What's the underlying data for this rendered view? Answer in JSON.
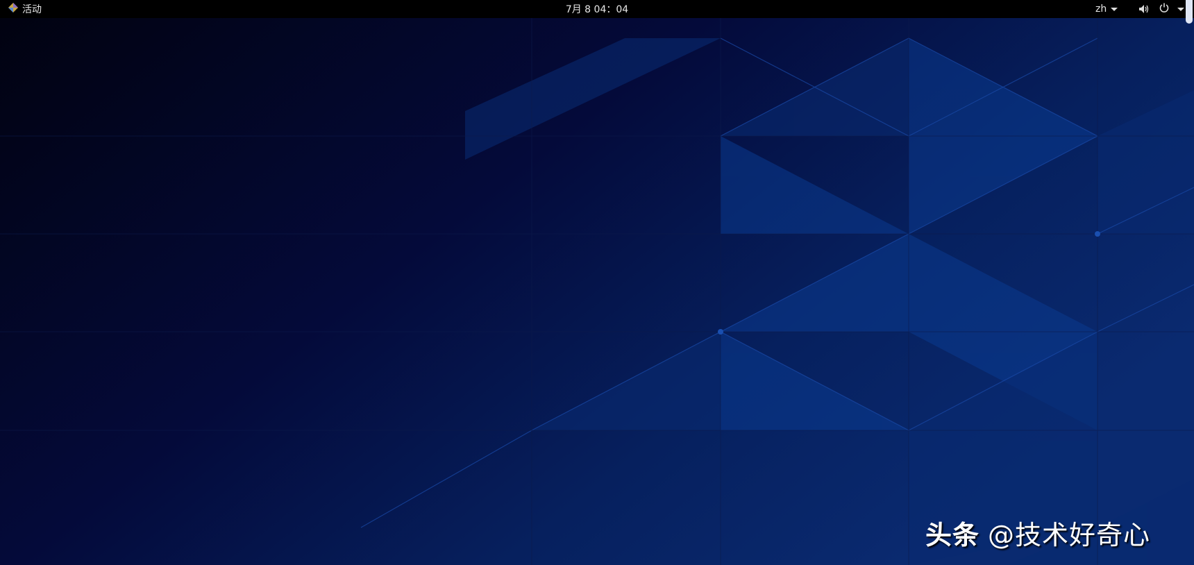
{
  "topbar": {
    "activities_label": "活动",
    "clock": "7月 8  04：04",
    "language": "zh"
  },
  "icons": [
    "app-logo-icon",
    "volume-icon",
    "power-icon",
    "caret-down-icon"
  ],
  "watermark": {
    "brand": "头条",
    "handle": "@技术好奇心"
  },
  "colors": {
    "topbar": "#000000",
    "wallpaper_dark": "#02051c",
    "wallpaper_blue": "#0a3a8a"
  }
}
